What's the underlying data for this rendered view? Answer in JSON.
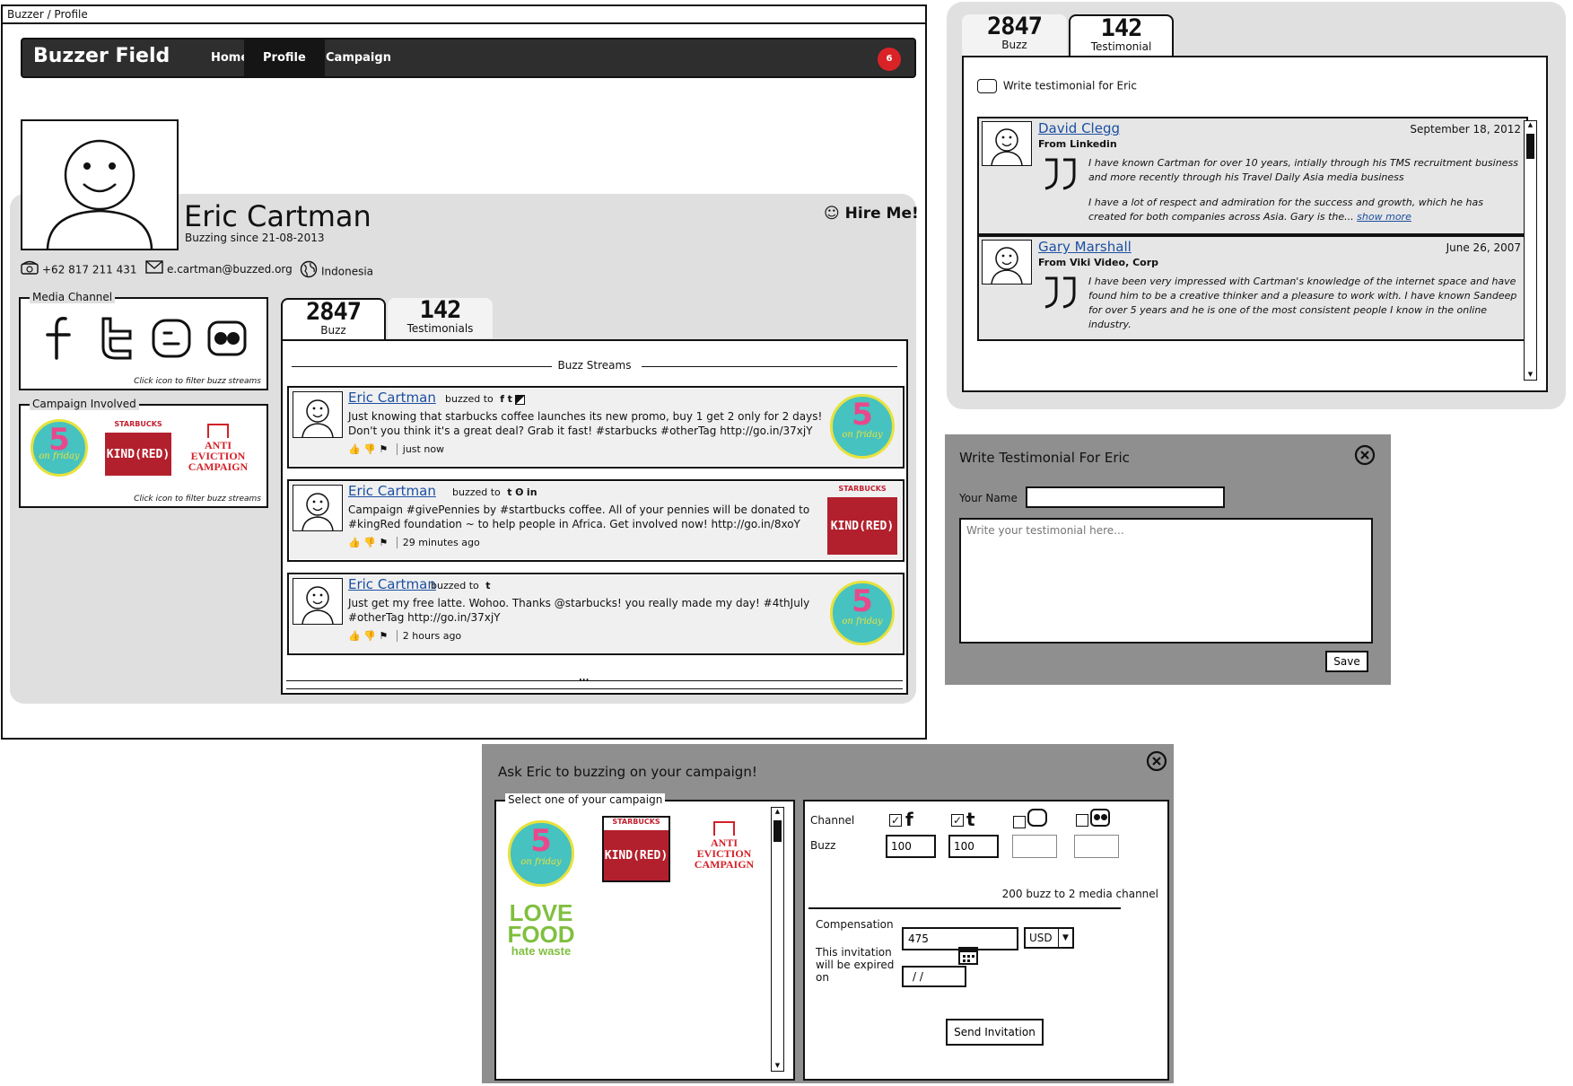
{
  "window": {
    "title": "Buzzer / Profile"
  },
  "navbar": {
    "brand": "Buzzer Field",
    "items": [
      {
        "label": "Home",
        "active": false
      },
      {
        "label": "Profile",
        "active": true
      },
      {
        "label": "Campaign",
        "active": false
      }
    ],
    "notification_count": "6"
  },
  "profile": {
    "name": "Eric Cartman",
    "since": "Buzzing since 21-08-2013",
    "hire_label": "Hire Me!",
    "phone": "+62 817 211 431",
    "email": "e.cartman@buzzed.org",
    "country": "Indonesia"
  },
  "media_channel": {
    "legend": "Media Channel",
    "icons": [
      "facebook-icon",
      "twitter-icon",
      "blogger-icon",
      "flickr-icon"
    ],
    "hint": "Click icon to filter buzz streams"
  },
  "campaign_involved": {
    "legend": "Campaign Involved",
    "campaigns": [
      "5 on Friday",
      "Starbucks Kind(Red)",
      "Anti Eviction Campaign"
    ],
    "hint": "Click icon to filter buzz streams"
  },
  "tabs": {
    "buzz_count": "2847",
    "buzz_label": "Buzz",
    "testimonial_count": "142",
    "testimonials_label": "Testimonials",
    "testimonial_label_short": "Testimonial"
  },
  "stream": {
    "heading": "Buzz Streams",
    "posts": [
      {
        "author": "Eric Cartman",
        "buzzed": "buzzed to",
        "text": "Just knowing that starbucks coffee launches its new promo, buy 1 get 2 only for 2 days! Don't you think it's a great deal? Grab it fast! #starbucks #otherTag http://go.in/37xjY",
        "time": "just now",
        "campaign": "5 on Friday"
      },
      {
        "author": "Eric Cartman",
        "buzzed": "buzzed to",
        "text": "Campaign #givePennies by #startbucks coffee. All of your pennies will be donated to #kingRed foundation ~ to help people in Africa. Get involved now! http://go.in/8xoY",
        "time": "29 minutes ago",
        "campaign": "Starbucks Kind(Red)"
      },
      {
        "author": "Eric Cartman",
        "buzzed": "buzzed to",
        "text": "Just get my free latte. Wohoo. Thanks @starbucks! you really made my day! #4thJuly #otherTag http://go.in/37xjY",
        "time": "2 hours ago",
        "campaign": "5 on Friday"
      }
    ],
    "more": "..."
  },
  "testimonials": {
    "write_link": "Write testimonial for Eric",
    "items": [
      {
        "name": "David Clegg",
        "from": "From Linkedin",
        "date": "September 18, 2012",
        "para1": "I have known Cartman for over 10 years, intially through his TMS recruitment business and more recently through his Travel Daily Asia media business",
        "para2": "I have a lot of respect and admiration for the success and growth, which he has created for both companies across Asia. Gary is the...",
        "show_more": "show more"
      },
      {
        "name": "Gary Marshall",
        "from": "From Viki Video, Corp",
        "date": "June 26, 2007",
        "para1": "I have been very impressed with Cartman's knowledge of the internet space and have found him to be a creative thinker and a pleasure to work with. I have known Sandeep for over 5 years and he is one of the most consistent people I know in the online industry."
      }
    ]
  },
  "write_dialog": {
    "title": "Write Testimonial For Eric",
    "name_label": "Your Name",
    "name_value": "",
    "text_placeholder": "Write your testimonial here...",
    "save_label": "Save"
  },
  "invite_dialog": {
    "title": "Ask Eric to buzzing on your campaign!",
    "select_legend": "Select one of your campaign",
    "campaigns": [
      "5 on Friday",
      "Starbucks Kind(Red)",
      "Anti Eviction Campaign",
      "Love Food hate waste"
    ],
    "channel_label": "Channel",
    "buzz_label": "Buzz",
    "channels": [
      {
        "icon": "facebook-icon",
        "checked": true,
        "value": "100"
      },
      {
        "icon": "twitter-icon",
        "checked": true,
        "value": "100"
      },
      {
        "icon": "blogger-icon",
        "checked": false,
        "value": ""
      },
      {
        "icon": "flickr-icon",
        "checked": false,
        "value": ""
      }
    ],
    "summary": "200 buzz to 2 media channel",
    "compensation_label": "Compensation",
    "compensation_value": "475",
    "currency": "USD",
    "expire_label": "This invitation will be expired on",
    "expire_value": "/ /",
    "send_label": "Send Invitation"
  },
  "campaign_logos": {
    "five_friday": {
      "num": "5",
      "script": "on friday"
    },
    "starbucks": {
      "brand": "STARBUCKS",
      "kind": "KIND(RED)"
    },
    "anti": {
      "line1": "ANTI",
      "line2": "EVICTION",
      "line3": "CAMPAIGN"
    },
    "lovefood": {
      "line1": "LOVE",
      "line2": "FOOD",
      "line3": "hate waste"
    }
  },
  "colors": {
    "navbar": "#2e2e2e",
    "badge": "#d92326",
    "link": "#1c4fa0",
    "panel": "#dfdfdf",
    "dialog": "#8f8f8f"
  }
}
